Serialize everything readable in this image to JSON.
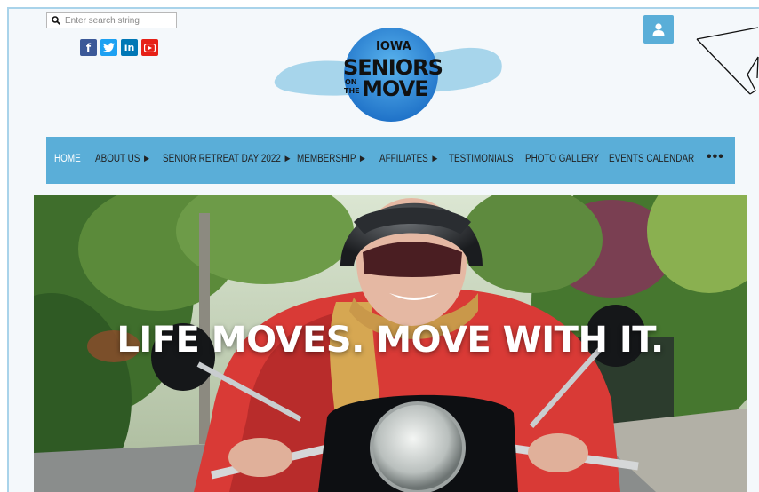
{
  "search": {
    "placeholder": "Enter search string"
  },
  "social": [
    {
      "name": "facebook",
      "glyph": "f",
      "color": "#3b5998"
    },
    {
      "name": "twitter",
      "glyph": "t",
      "color": "#1da1f2"
    },
    {
      "name": "linkedin",
      "glyph": "in",
      "color": "#0077b5"
    },
    {
      "name": "youtube",
      "glyph": "▶",
      "color": "#e62117"
    }
  ],
  "logo": {
    "top": "IOWA",
    "line1": "SENIORS",
    "on": "ON",
    "the": "THE",
    "line2": "MOVE"
  },
  "nav": {
    "items": [
      {
        "label": "HOME",
        "active": true
      },
      {
        "label": "ABOUT US ►"
      },
      {
        "label": "SENIOR RETREAT DAY 2022 ►"
      },
      {
        "label": "MEMBERSHIP ►"
      },
      {
        "label": "AFFILIATES ►"
      },
      {
        "label": "TESTIMONIALS"
      },
      {
        "label": "PHOTO GALLERY"
      },
      {
        "label": "EVENTS CALENDAR"
      }
    ],
    "more": "•••"
  },
  "hero": {
    "headline": "LIFE MOVES. MOVE WITH IT."
  },
  "colors": {
    "accent": "#5aaed8",
    "nav_active": "#ffffff",
    "frame": "#a9d3ea"
  }
}
